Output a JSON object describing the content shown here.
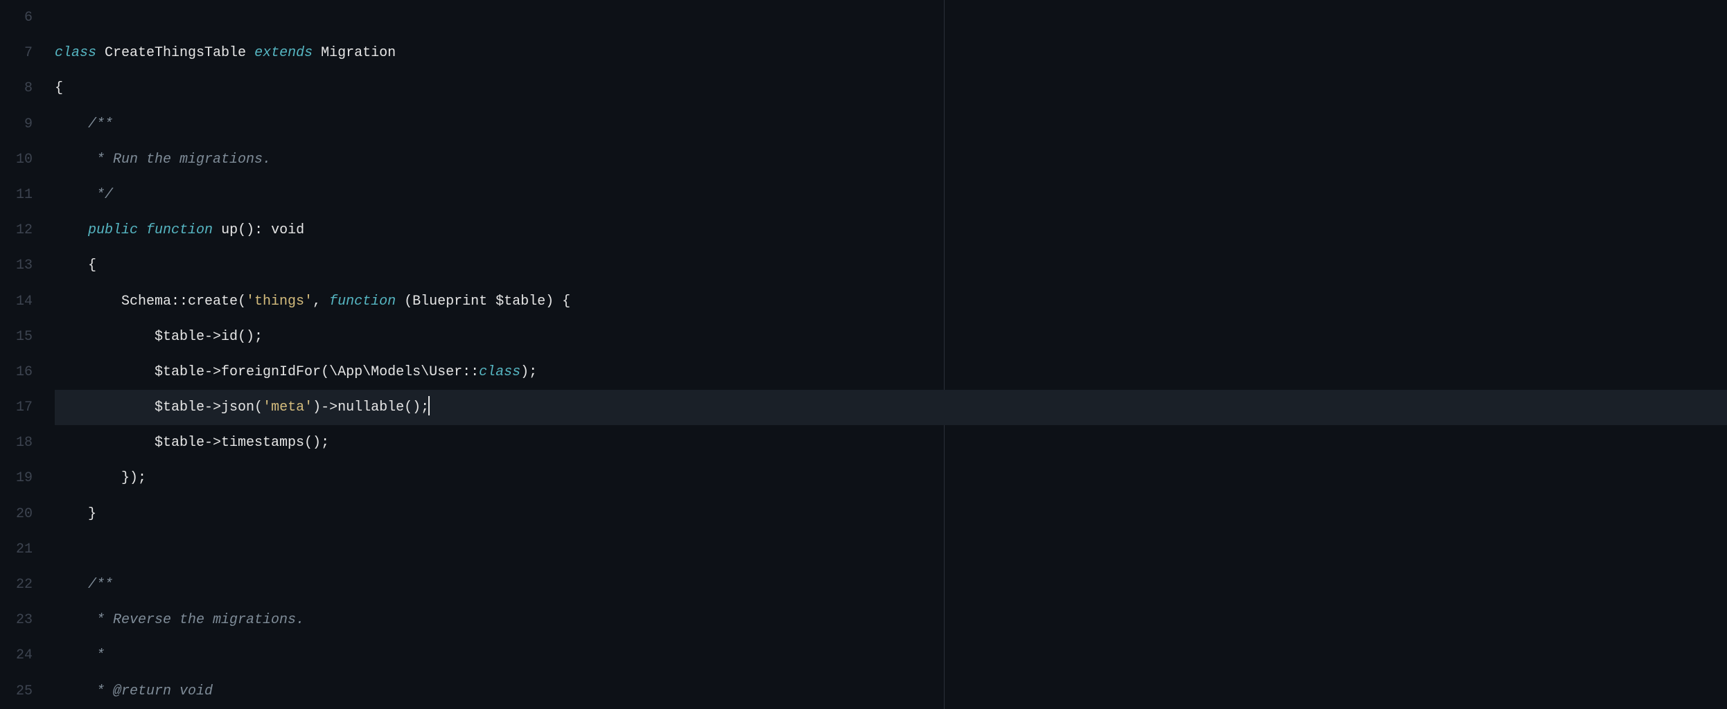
{
  "editor": {
    "active_line": 17,
    "gutter_start": 6,
    "gutter_end": 25,
    "rulers": [
      1287,
      2482
    ],
    "lines": [
      {
        "n": 6,
        "tokens": []
      },
      {
        "n": 7,
        "tokens": [
          {
            "t": "kw",
            "s": "class"
          },
          {
            "t": "plain",
            "s": " CreateThingsTable "
          },
          {
            "t": "kw",
            "s": "extends"
          },
          {
            "t": "plain",
            "s": " Migration"
          }
        ]
      },
      {
        "n": 8,
        "tokens": [
          {
            "t": "plain",
            "s": "{"
          }
        ]
      },
      {
        "n": 9,
        "tokens": [
          {
            "t": "plain",
            "s": "    "
          },
          {
            "t": "cmt",
            "s": "/**"
          }
        ]
      },
      {
        "n": 10,
        "tokens": [
          {
            "t": "plain",
            "s": "     "
          },
          {
            "t": "cmt",
            "s": "* Run the migrations."
          }
        ]
      },
      {
        "n": 11,
        "tokens": [
          {
            "t": "plain",
            "s": "     "
          },
          {
            "t": "cmt",
            "s": "*/"
          }
        ]
      },
      {
        "n": 12,
        "tokens": [
          {
            "t": "plain",
            "s": "    "
          },
          {
            "t": "kw",
            "s": "public"
          },
          {
            "t": "plain",
            "s": " "
          },
          {
            "t": "kw",
            "s": "function"
          },
          {
            "t": "plain",
            "s": " up(): void"
          }
        ]
      },
      {
        "n": 13,
        "tokens": [
          {
            "t": "plain",
            "s": "    {"
          }
        ]
      },
      {
        "n": 14,
        "tokens": [
          {
            "t": "plain",
            "s": "        Schema::create("
          },
          {
            "t": "str",
            "s": "'things'"
          },
          {
            "t": "plain",
            "s": ", "
          },
          {
            "t": "kw",
            "s": "function"
          },
          {
            "t": "plain",
            "s": " (Blueprint $table) {"
          }
        ]
      },
      {
        "n": 15,
        "tokens": [
          {
            "t": "plain",
            "s": "            $table->id();"
          }
        ]
      },
      {
        "n": 16,
        "tokens": [
          {
            "t": "plain",
            "s": "            $table->foreignIdFor(\\App\\Models\\User::"
          },
          {
            "t": "cls",
            "s": "class"
          },
          {
            "t": "plain",
            "s": ");"
          }
        ]
      },
      {
        "n": 17,
        "tokens": [
          {
            "t": "plain",
            "s": "            $table->json("
          },
          {
            "t": "str",
            "s": "'meta'"
          },
          {
            "t": "plain",
            "s": ")->nullable();"
          }
        ],
        "cursor_after": true
      },
      {
        "n": 18,
        "tokens": [
          {
            "t": "plain",
            "s": "            $table->timestamps();"
          }
        ]
      },
      {
        "n": 19,
        "tokens": [
          {
            "t": "plain",
            "s": "        });"
          }
        ]
      },
      {
        "n": 20,
        "tokens": [
          {
            "t": "plain",
            "s": "    }"
          }
        ]
      },
      {
        "n": 21,
        "tokens": []
      },
      {
        "n": 22,
        "tokens": [
          {
            "t": "plain",
            "s": "    "
          },
          {
            "t": "cmt",
            "s": "/**"
          }
        ]
      },
      {
        "n": 23,
        "tokens": [
          {
            "t": "plain",
            "s": "     "
          },
          {
            "t": "cmt",
            "s": "* Reverse the migrations."
          }
        ]
      },
      {
        "n": 24,
        "tokens": [
          {
            "t": "plain",
            "s": "     "
          },
          {
            "t": "cmt",
            "s": "*"
          }
        ]
      },
      {
        "n": 25,
        "tokens": [
          {
            "t": "plain",
            "s": "     "
          },
          {
            "t": "cmt",
            "s": "* @return "
          },
          {
            "t": "cmt",
            "s": "void"
          }
        ]
      }
    ]
  }
}
